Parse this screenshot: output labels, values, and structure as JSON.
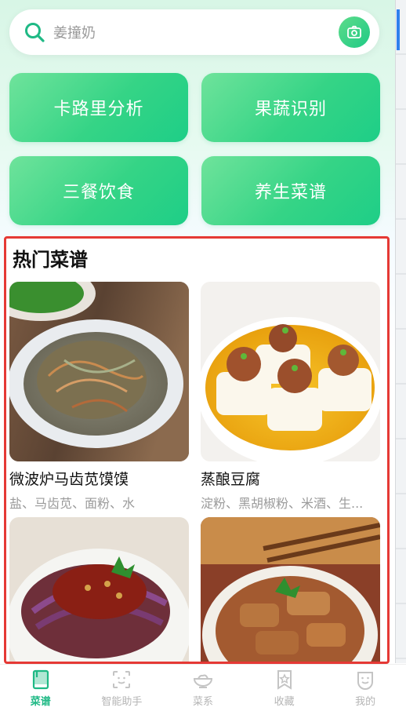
{
  "search": {
    "placeholder": "姜撞奶"
  },
  "features": [
    "卡路里分析",
    "果蔬识别",
    "三餐饮食",
    "养生菜谱"
  ],
  "hot": {
    "title": "热门菜谱",
    "recipes": [
      {
        "name": "微波炉马齿苋馍馍",
        "ingredients": "盐、马齿苋、面粉、水"
      },
      {
        "name": "蒸酿豆腐",
        "ingredients": "淀粉、黑胡椒粉、米酒、生..."
      },
      {
        "name": "",
        "ingredients": ""
      },
      {
        "name": "",
        "ingredients": ""
      }
    ]
  },
  "tabs": [
    "菜谱",
    "智能助手",
    "菜系",
    "收藏",
    "我的"
  ],
  "colors": {
    "accent": "#1fb985",
    "button": "#35d486",
    "highlight_border": "#e53935"
  }
}
